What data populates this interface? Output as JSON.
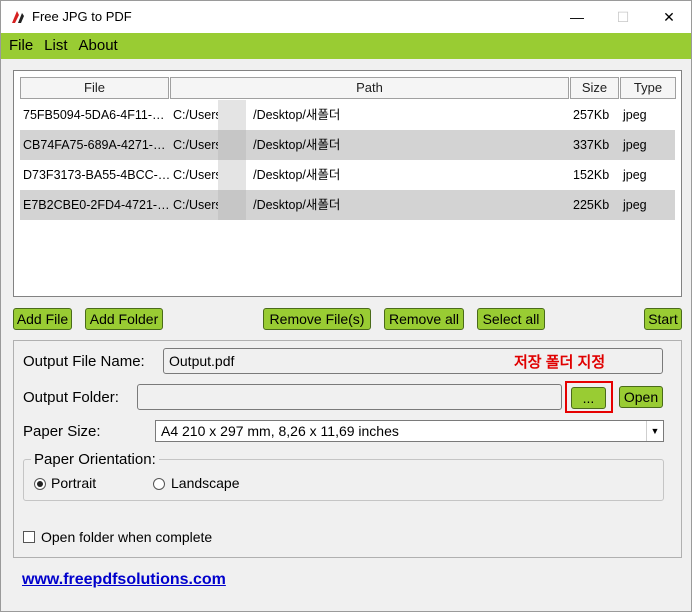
{
  "window": {
    "title": "Free JPG to PDF",
    "controls": {
      "minimize": "—",
      "maximize": "☐",
      "close": "✕"
    }
  },
  "menu": [
    "File",
    "List",
    "About"
  ],
  "file_list": {
    "columns": [
      "File",
      "Path",
      "Size",
      "Type"
    ],
    "rows": [
      {
        "file": "75FB5094-5DA6-4F11-…",
        "path_prefix": "C:/Users/",
        "path_suffix": "/Desktop/새폴더",
        "size": "257Kb",
        "type": "jpeg"
      },
      {
        "file": "CB74FA75-689A-4271-…",
        "path_prefix": "C:/Users/",
        "path_suffix": "/Desktop/새폴더",
        "size": "337Kb",
        "type": "jpeg"
      },
      {
        "file": "D73F3173-BA55-4BCC-…",
        "path_prefix": "C:/Users/",
        "path_suffix": "/Desktop/새폴더",
        "size": "152Kb",
        "type": "jpeg"
      },
      {
        "file": "E7B2CBE0-2FD4-4721-…",
        "path_prefix": "C:/Users/",
        "path_suffix": "/Desktop/새폴더",
        "size": "225Kb",
        "type": "jpeg"
      }
    ]
  },
  "buttons": {
    "add_file": "Add File",
    "add_folder": "Add Folder",
    "remove_files": "Remove File(s)",
    "remove_all": "Remove all",
    "select_all": "Select all",
    "start": "Start",
    "browse": "...",
    "open": "Open"
  },
  "options": {
    "output_file_label": "Output File Name:",
    "output_file_value": "Output.pdf",
    "annotation": "저장 폴더 지정",
    "output_folder_label": "Output Folder:",
    "output_folder_value": "",
    "paper_size_label": "Paper Size:",
    "paper_size_value": "A4 210 x 297 mm, 8,26 x 11,69 inches",
    "orientation_title": "Paper Orientation:",
    "portrait": "Portrait",
    "landscape": "Landscape",
    "open_when_complete": "Open folder when complete"
  },
  "footer_link": "www.freepdfsolutions.com",
  "colors": {
    "accent": "#99cc33",
    "annotation": "#e00000",
    "link": "#0000cc"
  }
}
